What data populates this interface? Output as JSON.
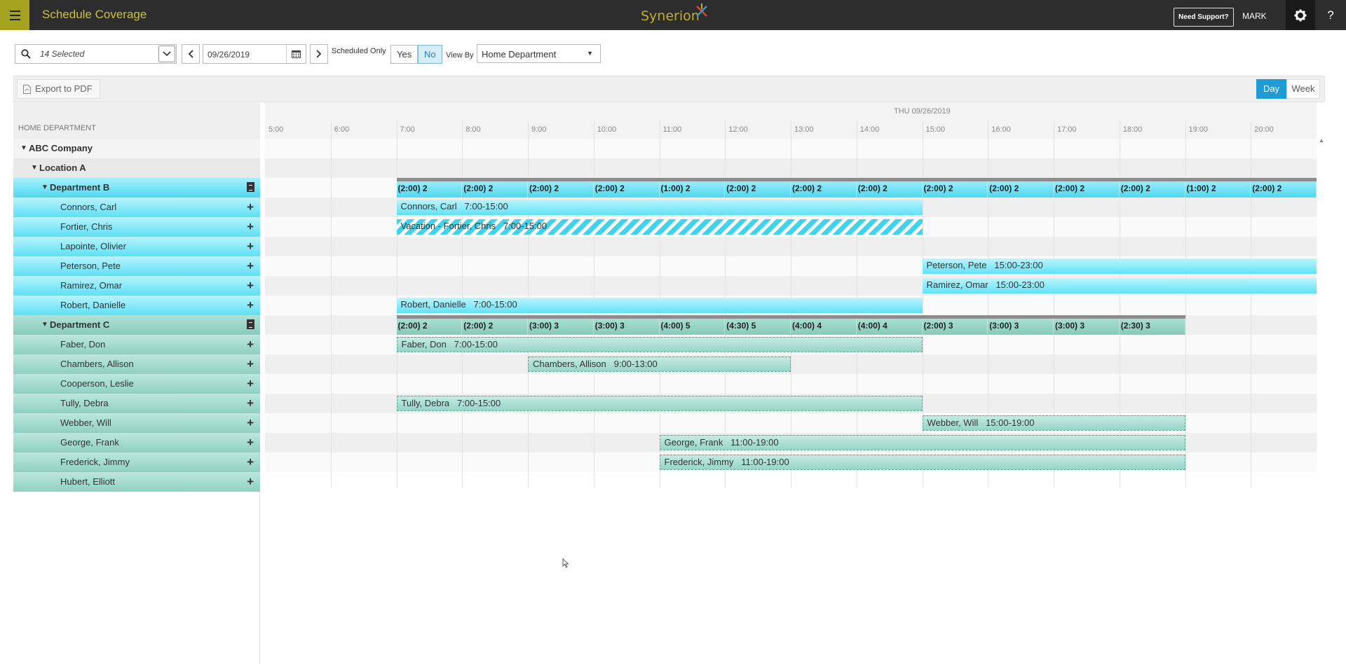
{
  "app": {
    "title": "Schedule Coverage",
    "logo": "Synerion",
    "support_label": "Need Support?",
    "user": "MARK",
    "help": "?"
  },
  "toolbar": {
    "selected": "14 Selected",
    "date": "09/26/2019",
    "scheduled_only_label": "Scheduled Only",
    "yes_label": "Yes",
    "no_label": "No",
    "scheduled_only_value": "No",
    "view_by_label": "View By",
    "view_by_value": "Home Department"
  },
  "subbar": {
    "export_label": "Export to PDF",
    "day_label": "Day",
    "week_label": "Week",
    "active_view": "Day"
  },
  "tree": {
    "header": "HOME DEPARTMENT",
    "company": "ABC Company",
    "location": "Location A",
    "dept_b": {
      "name": "Department B",
      "employees": [
        "Connors, Carl",
        "Fortier, Chris",
        "Lapointe, Olivier",
        "Peterson, Pete",
        "Ramirez, Omar",
        "Robert, Danielle"
      ]
    },
    "dept_c": {
      "name": "Department C",
      "employees": [
        "Faber, Don",
        "Chambers, Allison",
        "Cooperson, Leslie",
        "Tully, Debra",
        "Webber, Will",
        "George, Frank",
        "Frederick, Jimmy",
        "Hubert, Elliott"
      ]
    }
  },
  "timeline": {
    "date_header": "THU 09/26/2019",
    "hours": [
      "5:00",
      "6:00",
      "7:00",
      "8:00",
      "9:00",
      "10:00",
      "11:00",
      "12:00",
      "13:00",
      "14:00",
      "15:00",
      "16:00",
      "17:00",
      "18:00",
      "19:00",
      "20:00"
    ],
    "dept_b_coverage": [
      "(2:00) 2",
      "(2:00) 2",
      "(2:00) 2",
      "(2:00) 2",
      "(1:00) 2",
      "(2:00) 2",
      "(2:00) 2",
      "(2:00) 2",
      "(2:00) 2",
      "(2:00) 2",
      "(2:00) 2",
      "(2:00) 2",
      "(1:00) 2",
      "(2:00) 2"
    ],
    "dept_c_coverage": [
      "(2:00) 2",
      "(2:00) 2",
      "(3:00) 3",
      "(3:00) 3",
      "(4:00) 5",
      "(4:30) 5",
      "(4:00) 4",
      "(4:00) 4",
      "(2:00) 3",
      "(3:00) 3",
      "(3:00) 3",
      "(2:30) 3"
    ],
    "shifts": [
      {
        "label": "Connors, Carl   7:00-15:00",
        "start": "7:00",
        "end": "15:00",
        "row": 1,
        "style": "blue"
      },
      {
        "label": "Vacation - Fortier, Chris   7:00-15:00",
        "start": "7:00",
        "end": "15:00",
        "row": 2,
        "style": "vacation"
      },
      {
        "label": "Peterson, Pete   15:00-23:00",
        "start": "15:00",
        "end": "23:00",
        "row": 4,
        "style": "blue"
      },
      {
        "label": "Ramirez, Omar   15:00-23:00",
        "start": "15:00",
        "end": "23:00",
        "row": 5,
        "style": "blue"
      },
      {
        "label": "Robert, Danielle   7:00-15:00",
        "start": "7:00",
        "end": "15:00",
        "row": 6,
        "style": "blue"
      },
      {
        "label": "Faber, Don   7:00-15:00",
        "start": "7:00",
        "end": "15:00",
        "row": 8,
        "style": "green"
      },
      {
        "label": "Chambers, Allison   9:00-13:00",
        "start": "9:00",
        "end": "13:00",
        "row": 9,
        "style": "green"
      },
      {
        "label": "Tully, Debra   7:00-15:00",
        "start": "7:00",
        "end": "15:00",
        "row": 11,
        "style": "green"
      },
      {
        "label": "Webber, Will   15:00-19:00",
        "start": "15:00",
        "end": "19:00",
        "row": 12,
        "style": "green"
      },
      {
        "label": "George, Frank   11:00-19:00",
        "start": "11:00",
        "end": "19:00",
        "row": 13,
        "style": "green"
      },
      {
        "label": "Frederick, Jimmy   11:00-19:00",
        "start": "11:00",
        "end": "19:00",
        "row": 14,
        "style": "green"
      }
    ]
  },
  "colors": {
    "accent": "#1f9bd6",
    "topbar": "#2d2d2d",
    "menu": "#a4a21f",
    "dept_b": "#5ee0f4",
    "dept_c": "#8fd0c2"
  }
}
